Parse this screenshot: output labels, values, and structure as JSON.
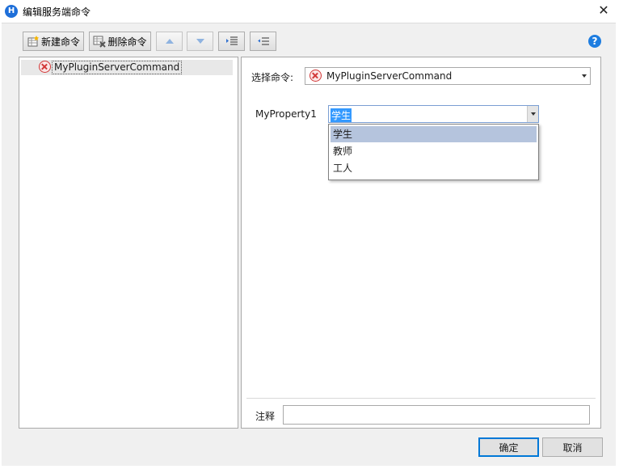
{
  "window": {
    "title": "编辑服务端命令",
    "app_icon_letter": "H"
  },
  "toolbar": {
    "new_label": "新建命令",
    "delete_label": "删除命令"
  },
  "tree": {
    "items": [
      {
        "label": "MyPluginServerCommand",
        "status_icon": "error-icon"
      }
    ]
  },
  "form": {
    "select_command_label": "选择命令:",
    "select_command_value": "MyPluginServerCommand",
    "property_label": "MyProperty1",
    "property_value": "学生",
    "property_options": [
      "学生",
      "教师",
      "工人"
    ],
    "note_label": "注释",
    "note_value": ""
  },
  "buttons": {
    "ok": "确定",
    "cancel": "取消"
  },
  "colors": {
    "accent": "#0078d7",
    "selection": "#3399ff",
    "list_highlight": "#b5c4dd",
    "error": "#d23838"
  }
}
